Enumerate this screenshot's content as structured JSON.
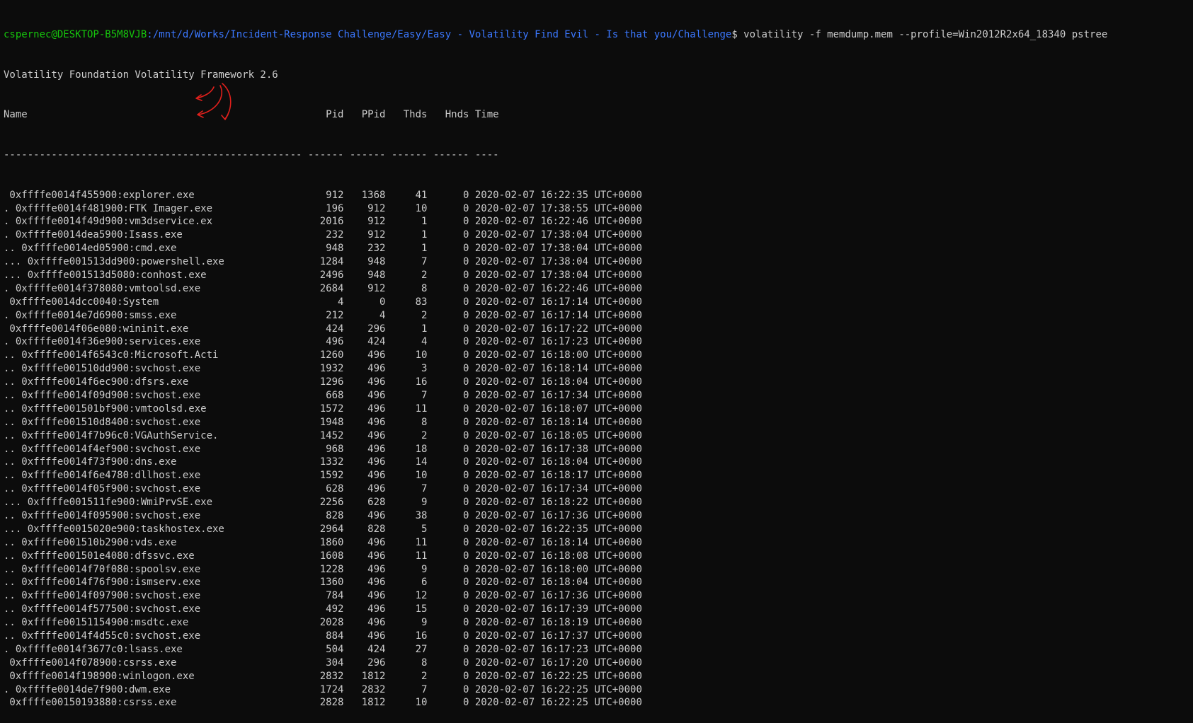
{
  "terminal": {
    "prompt_user_host": "cspernec@DESKTOP-B5M8VJB",
    "prompt_path": ":/mnt/d/Works/Incident-Response Challenge/Easy/Easy - Volatility Find Evil - Is that you/Challenge",
    "prompt_command": "$ volatility -f memdump.mem --profile=Win2012R2x64_18340 pstree",
    "banner": "Volatility Foundation Volatility Framework 2.6",
    "header": "Name                                                  Pid   PPid   Thds   Hnds Time",
    "separator": "-------------------------------------------------- ------ ------ ------ ------ ----",
    "rows": [
      " 0xffffe0014f455900:explorer.exe                      912   1368     41      0 2020-02-07 16:22:35 UTC+0000",
      ". 0xffffe0014f481900:FTK Imager.exe                   196    912     10      0 2020-02-07 17:38:55 UTC+0000",
      ". 0xffffe0014f49d900:vm3dservice.ex                  2016    912      1      0 2020-02-07 16:22:46 UTC+0000",
      ". 0xffffe0014dea5900:Isass.exe                        232    912      1      0 2020-02-07 17:38:04 UTC+0000",
      ".. 0xffffe0014ed05900:cmd.exe                         948    232      1      0 2020-02-07 17:38:04 UTC+0000",
      "... 0xffffe001513dd900:powershell.exe                1284    948      7      0 2020-02-07 17:38:04 UTC+0000",
      "... 0xffffe001513d5080:conhost.exe                   2496    948      2      0 2020-02-07 17:38:04 UTC+0000",
      ". 0xffffe0014f378080:vmtoolsd.exe                    2684    912      8      0 2020-02-07 16:22:46 UTC+0000",
      " 0xffffe0014dcc0040:System                              4      0     83      0 2020-02-07 16:17:14 UTC+0000",
      ". 0xffffe0014e7d6900:smss.exe                         212      4      2      0 2020-02-07 16:17:14 UTC+0000",
      " 0xffffe0014f06e080:wininit.exe                       424    296      1      0 2020-02-07 16:17:22 UTC+0000",
      ". 0xffffe0014f36e900:services.exe                     496    424      4      0 2020-02-07 16:17:23 UTC+0000",
      ".. 0xffffe0014f6543c0:Microsoft.Acti                 1260    496     10      0 2020-02-07 16:18:00 UTC+0000",
      ".. 0xffffe001510dd900:svchost.exe                    1932    496      3      0 2020-02-07 16:18:14 UTC+0000",
      ".. 0xffffe0014f6ec900:dfsrs.exe                      1296    496     16      0 2020-02-07 16:18:04 UTC+0000",
      ".. 0xffffe0014f09d900:svchost.exe                     668    496      7      0 2020-02-07 16:17:34 UTC+0000",
      ".. 0xffffe001501bf900:vmtoolsd.exe                   1572    496     11      0 2020-02-07 16:18:07 UTC+0000",
      ".. 0xffffe001510d8400:svchost.exe                    1948    496      8      0 2020-02-07 16:18:14 UTC+0000",
      ".. 0xffffe0014f7b96c0:VGAuthService.                 1452    496      2      0 2020-02-07 16:18:05 UTC+0000",
      ".. 0xffffe0014f4ef900:svchost.exe                     968    496     18      0 2020-02-07 16:17:38 UTC+0000",
      ".. 0xffffe0014f73f900:dns.exe                        1332    496     14      0 2020-02-07 16:18:04 UTC+0000",
      ".. 0xffffe0014f6e4780:dllhost.exe                    1592    496     10      0 2020-02-07 16:18:17 UTC+0000",
      ".. 0xffffe0014f05f900:svchost.exe                     628    496      7      0 2020-02-07 16:17:34 UTC+0000",
      "... 0xffffe001511fe900:WmiPrvSE.exe                  2256    628      9      0 2020-02-07 16:18:22 UTC+0000",
      ".. 0xffffe0014f095900:svchost.exe                     828    496     38      0 2020-02-07 16:17:36 UTC+0000",
      "... 0xffffe0015020e900:taskhostex.exe                2964    828      5      0 2020-02-07 16:22:35 UTC+0000",
      ".. 0xffffe001510b2900:vds.exe                        1860    496     11      0 2020-02-07 16:18:14 UTC+0000",
      ".. 0xffffe001501e4080:dfssvc.exe                     1608    496     11      0 2020-02-07 16:18:08 UTC+0000",
      ".. 0xffffe0014f70f080:spoolsv.exe                    1228    496      9      0 2020-02-07 16:18:00 UTC+0000",
      ".. 0xffffe0014f76f900:ismserv.exe                    1360    496      6      0 2020-02-07 16:18:04 UTC+0000",
      ".. 0xffffe0014f097900:svchost.exe                     784    496     12      0 2020-02-07 16:17:36 UTC+0000",
      ".. 0xffffe0014f577500:svchost.exe                     492    496     15      0 2020-02-07 16:17:39 UTC+0000",
      ".. 0xffffe00151154900:msdtc.exe                      2028    496      9      0 2020-02-07 16:18:19 UTC+0000",
      ".. 0xffffe0014f4d55c0:svchost.exe                     884    496     16      0 2020-02-07 16:17:37 UTC+0000",
      ". 0xffffe0014f3677c0:lsass.exe                        504    424     27      0 2020-02-07 16:17:23 UTC+0000",
      " 0xffffe0014f078900:csrss.exe                         304    296      8      0 2020-02-07 16:17:20 UTC+0000",
      " 0xffffe0014f198900:winlogon.exe                     2832   1812      2      0 2020-02-07 16:22:25 UTC+0000",
      ". 0xffffe0014de7f900:dwm.exe                         1724   2832      7      0 2020-02-07 16:22:25 UTC+0000",
      " 0xffffe00150193880:csrss.exe                        2828   1812     10      0 2020-02-07 16:22:25 UTC+0000"
    ]
  },
  "colors": {
    "background": "#0c0c0c",
    "text": "#cccccc",
    "prompt_user": "#16c60c",
    "prompt_path": "#3b78ff",
    "annotation": "#e0201c"
  }
}
